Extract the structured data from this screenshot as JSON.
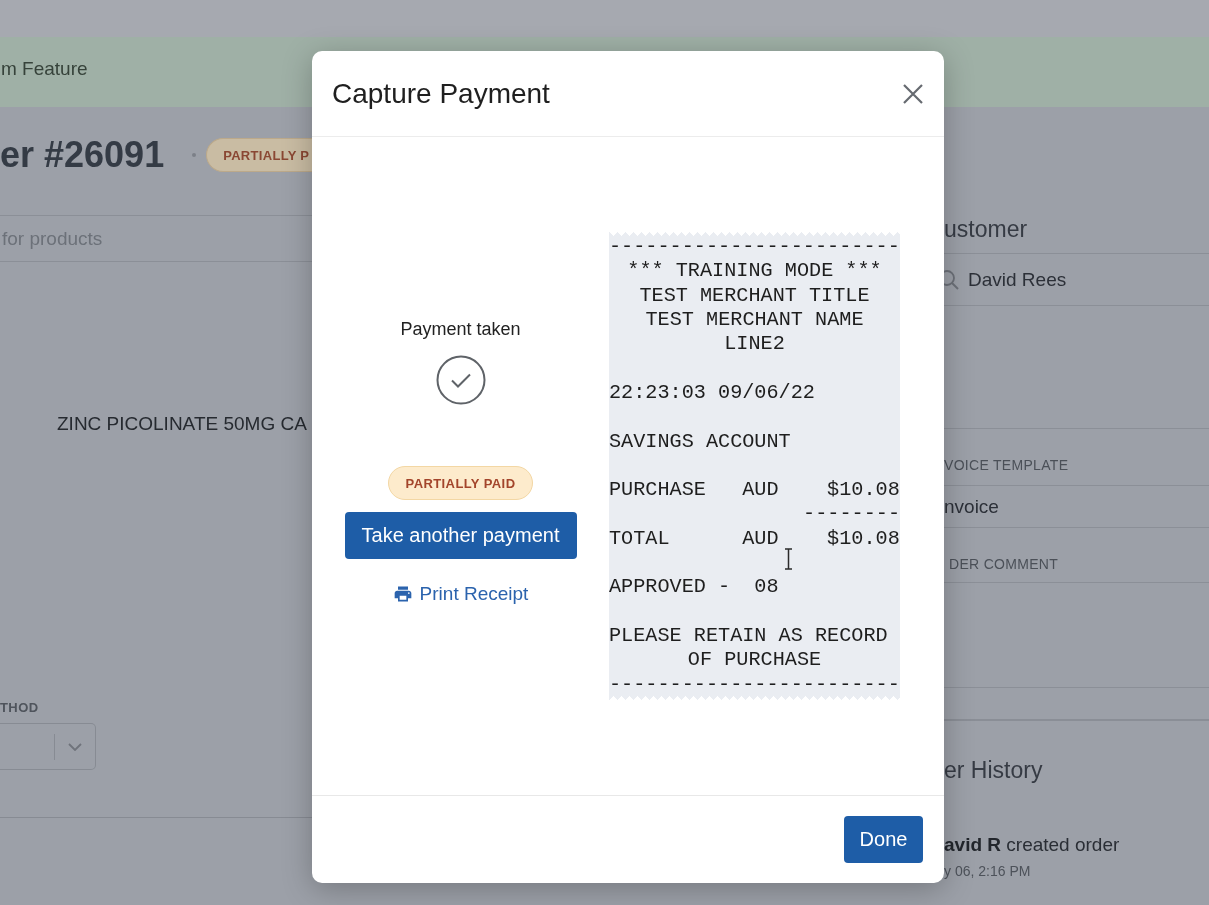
{
  "background_page": {
    "banner": {
      "text": "m Feature"
    },
    "order": {
      "title": "er #26091",
      "status_badge": "PARTIALLY P"
    },
    "product_search": {
      "placeholder": "for products"
    },
    "line_items": [
      {
        "name": "ZINC PICOLINATE 50MG CA"
      }
    ],
    "payment_method": {
      "label": "THOD"
    },
    "customer_panel": {
      "title": "ustomer",
      "customer": "David Rees",
      "invoice_template_label": "VOICE TEMPLATE",
      "invoice_template": "nvoice",
      "order_comment_label": "DER COMMENT"
    },
    "history": {
      "title": "er History",
      "entries": [
        {
          "text": "**avid R** created order",
          "time": "y 06, 2:16 PM"
        }
      ]
    }
  },
  "modal": {
    "title": "Capture Payment",
    "status_text": "Payment taken",
    "status_badge": "PARTIALLY PAID",
    "primary_action": "Take another payment",
    "print_link": "Print Receipt",
    "receipt": {
      "sections": [
        {
          "lines": [
            {
              "text": "------------------------",
              "kind": "left"
            },
            {
              "text": "*** TRAINING MODE ***",
              "kind": "center"
            },
            {
              "text": "TEST MERCHANT TITLE",
              "kind": "center"
            },
            {
              "text": "TEST MERCHANT NAME",
              "kind": "center"
            },
            {
              "text": "LINE2",
              "kind": "center"
            }
          ]
        },
        {
          "lines": [
            {
              "text": "22:23:03 09/06/22",
              "kind": "left"
            }
          ]
        },
        {
          "lines": [
            {
              "text": "SAVINGS ACCOUNT",
              "kind": "left"
            }
          ]
        },
        {
          "lines": [
            {
              "text": "PURCHASE   AUD    $10.08",
              "kind": "left"
            },
            {
              "text": "--------",
              "kind": "right"
            },
            {
              "text": "TOTAL      AUD    $10.08",
              "kind": "left"
            }
          ]
        },
        {
          "lines": [
            {
              "text": "APPROVED -  08",
              "kind": "left"
            }
          ]
        },
        {
          "lines": [
            {
              "text": "PLEASE RETAIN AS RECORD",
              "kind": "left"
            },
            {
              "text": "OF PURCHASE",
              "kind": "center"
            },
            {
              "text": "------------------------",
              "kind": "left"
            }
          ]
        }
      ]
    },
    "done_button": "Done"
  }
}
